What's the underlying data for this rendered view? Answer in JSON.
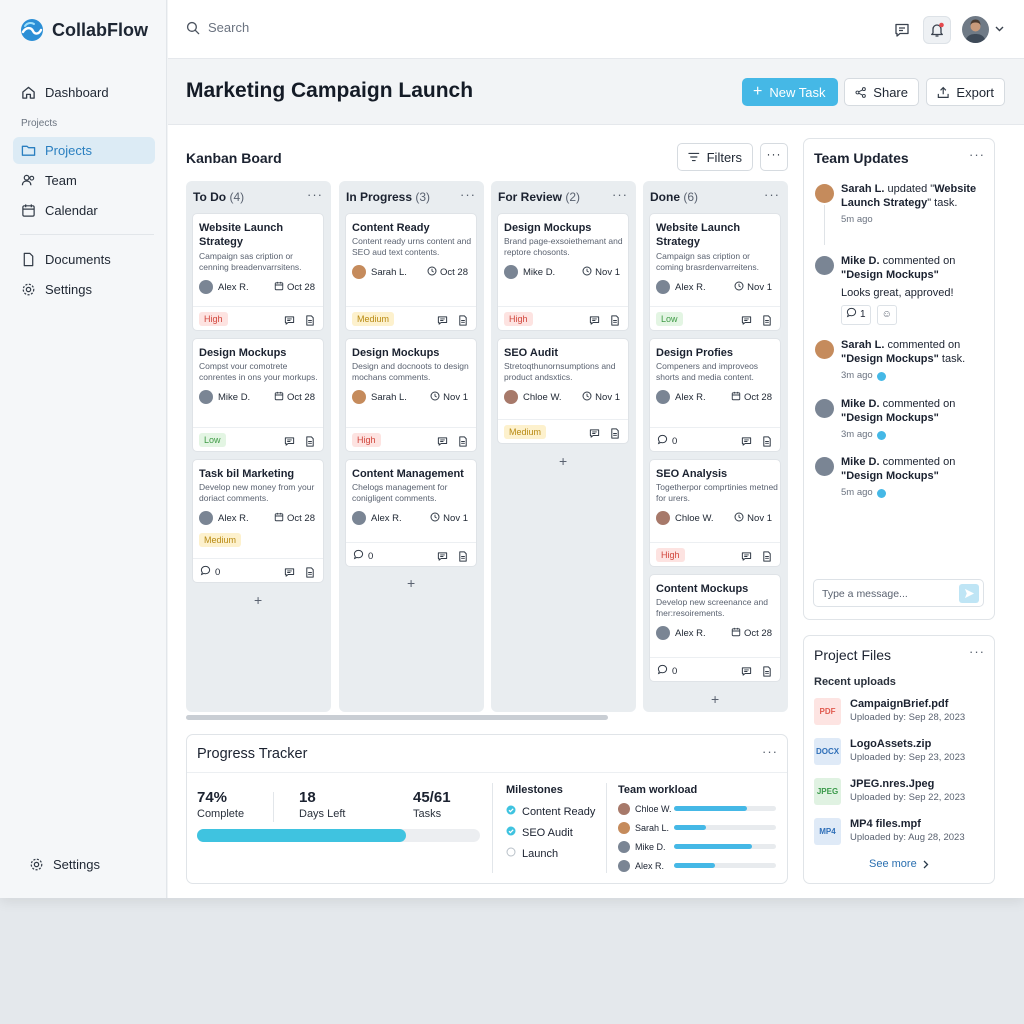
{
  "app": {
    "name": "CollabFlow"
  },
  "sidebar": {
    "section_label": "Projects",
    "items": [
      {
        "label": "Dashboard",
        "icon": "home-icon"
      },
      {
        "label": "Projects",
        "icon": "folder-icon",
        "active": true
      },
      {
        "label": "Team",
        "icon": "users-icon"
      },
      {
        "label": "Calendar",
        "icon": "calendar-icon"
      },
      {
        "label": "Documents",
        "icon": "document-icon"
      },
      {
        "label": "Settings",
        "icon": "gear-icon"
      }
    ],
    "bottom_settings": "Settings"
  },
  "topbar": {
    "search_placeholder": "Search"
  },
  "header": {
    "title": "Marketing Campaign Launch",
    "new_task": "New Task",
    "share": "Share",
    "export": "Export"
  },
  "kanban": {
    "title": "Kanban Board",
    "filters": "Filters",
    "columns": [
      {
        "name": "To Do",
        "count": "(4)",
        "cards": [
          {
            "title": "Website Launch Strategy",
            "desc": "Campaign sas cription or cenning breadenvarrsitens.",
            "assignee": "Alex R.",
            "due": "Oct 28",
            "priority": "High"
          },
          {
            "title": "Design Mockups",
            "desc": "Compst vour comotrete conrentes in ons your morkups.",
            "assignee": "Mike D.",
            "due": "Oct 28",
            "priority": "Low"
          },
          {
            "title": "Task bil Marketing",
            "desc": "Develop new money from your doriact comments.",
            "assignee": "Alex R.",
            "due": "Oct 28",
            "priority": "Medium",
            "comments": "0"
          }
        ]
      },
      {
        "name": "In Progress",
        "count": "(3)",
        "cards": [
          {
            "title": "Content Ready",
            "desc": "Content ready urns content and SEO aud text contents.",
            "assignee": "Sarah L.",
            "due": "Oct 28",
            "priority": "Medium"
          },
          {
            "title": "Design Mockups",
            "desc": "Design and docnoots to design mochans comments.",
            "assignee": "Sarah L.",
            "due": "Nov 1",
            "priority": "High"
          },
          {
            "title": "Content Management",
            "desc": "Chelogs management for conigligent comments.",
            "assignee": "Alex R.",
            "due": "Nov 1",
            "comments": "0"
          }
        ]
      },
      {
        "name": "For Review",
        "count": "(2)",
        "cards": [
          {
            "title": "Design Mockups",
            "desc": "Brand page-exsoiethemant and reptore chosonts.",
            "assignee": "Mike D.",
            "due": "Nov 1",
            "priority": "High"
          },
          {
            "title": "SEO Audit",
            "desc": "Stretoqthunornsumptions and product andsxtics.",
            "assignee": "Chloe W.",
            "due": "Nov 1",
            "priority": "Medium"
          }
        ]
      },
      {
        "name": "Done",
        "count": "(6)",
        "cards": [
          {
            "title": "Website Launch Strategy",
            "desc": "Campaign sas cription or coming brasrdenvarreitens.",
            "assignee": "Alex R.",
            "due": "Nov 1",
            "priority": "Low"
          },
          {
            "title": "Design Profies",
            "desc": "Compeners and improveos shorts and media content.",
            "assignee": "Alex R.",
            "due": "Oct 28",
            "comments": "0"
          },
          {
            "title": "SEO Analysis",
            "desc": "Togetherpor comprtinies metned for urers.",
            "assignee": "Chloe W.",
            "due": "Nov 1",
            "priority": "High"
          },
          {
            "title": "Content Mockups",
            "desc": "Develop new screenance and fner:resoirements.",
            "assignee": "Alex R.",
            "due": "Oct 28",
            "comments": "0"
          }
        ]
      }
    ]
  },
  "progress": {
    "title": "Progress Tracker",
    "percent_value": "74%",
    "percent_label": "Complete",
    "days_value": "18",
    "days_label": "Days Left",
    "tasks_value": "45/61",
    "tasks_label": "Tasks",
    "progress_fraction": 0.74,
    "milestones_title": "Milestones",
    "milestones": [
      {
        "label": "Content Ready",
        "done": true
      },
      {
        "label": "SEO Audit",
        "done": true
      },
      {
        "label": "Launch",
        "done": false
      }
    ],
    "workload_title": "Team workload",
    "workload": [
      {
        "name": "Chloe W.",
        "fraction": 0.72
      },
      {
        "name": "Sarah L.",
        "fraction": 0.31
      },
      {
        "name": "Mike D.",
        "fraction": 0.76
      },
      {
        "name": "Alex R.",
        "fraction": 0.4
      }
    ]
  },
  "team_updates": {
    "title": "Team Updates",
    "items": [
      {
        "who": "Sarah L.",
        "action": " updated \"",
        "target": "Website Launch Strategy",
        "tail": "\" task.",
        "time": "5m ago"
      },
      {
        "who": "Mike D.",
        "action": " commented on",
        "target": "\"Design Mockups\"",
        "comment": "Looks great, approved!",
        "likes": "1"
      },
      {
        "who": "Sarah L.",
        "action": " commented on",
        "target": "\"Design Mockups\"",
        "tail": " task.",
        "time": "3m ago"
      },
      {
        "who": "Mike D.",
        "action": " commented on",
        "target": "\"Design Mockups\"",
        "time": "3m ago"
      },
      {
        "who": "Mike D.",
        "action": " commented on",
        "target": "\"Design Mockups\"",
        "time": "5m ago"
      }
    ],
    "message_placeholder": "Type a message..."
  },
  "files": {
    "title": "Project Files",
    "subtitle": "Recent uploads",
    "items": [
      {
        "type": "PDF",
        "name": "CampaignBrief.pdf",
        "meta": "Uploaded by: Sep 28, 2023",
        "color": "#e05a4f",
        "bg": "#fde4e2"
      },
      {
        "type": "DOCX",
        "name": "LogoAssets.zip",
        "meta": "Uploaded by: Sep 23, 2023",
        "color": "#2f6fb8",
        "bg": "#dfeaf7"
      },
      {
        "type": "JPEG",
        "name": "JPEG.nres.Jpeg",
        "meta": "Uploaded by: Sep 22, 2023",
        "color": "#3a9a4a",
        "bg": "#e0f2e2"
      },
      {
        "type": "MP4",
        "name": "MP4 files.mpf",
        "meta": "Uploaded by: Aug 28, 2023",
        "color": "#2f6fb8",
        "bg": "#dfeaf7"
      }
    ],
    "see_more": "See more"
  },
  "colors": {
    "accent": "#45b8e6",
    "high": "#d1453b",
    "low": "#3e9a45",
    "medium": "#b88a12"
  }
}
